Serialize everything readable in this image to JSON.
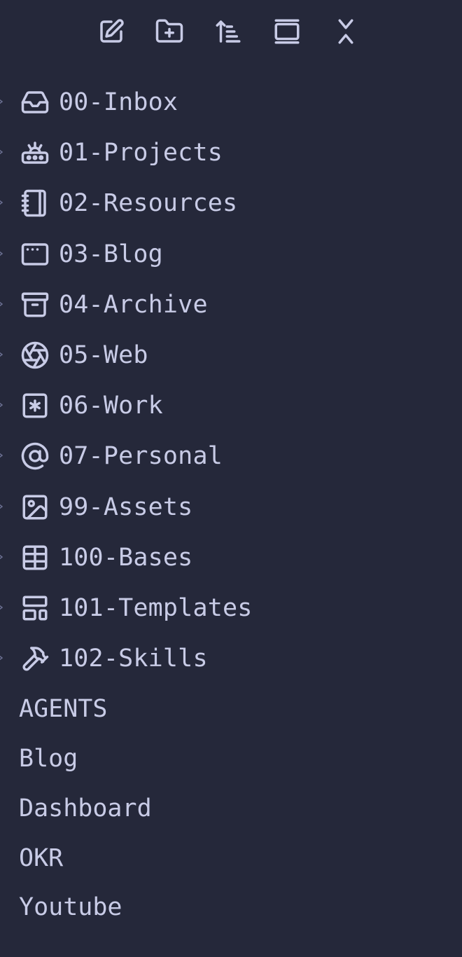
{
  "toolbar": {
    "buttons": [
      {
        "name": "new-note-button",
        "icon": "edit-icon"
      },
      {
        "name": "new-folder-button",
        "icon": "folder-plus-icon"
      },
      {
        "name": "sort-button",
        "icon": "sort-icon"
      },
      {
        "name": "auto-reveal-button",
        "icon": "reveal-icon"
      },
      {
        "name": "collapse-all-button",
        "icon": "collapse-icon"
      }
    ]
  },
  "folders": [
    {
      "label": "00-Inbox",
      "icon": "inbox-icon"
    },
    {
      "label": "01-Projects",
      "icon": "projects-icon"
    },
    {
      "label": "02-Resources",
      "icon": "notebook-icon"
    },
    {
      "label": "03-Blog",
      "icon": "browser-icon"
    },
    {
      "label": "04-Archive",
      "icon": "archive-icon"
    },
    {
      "label": "05-Web",
      "icon": "aperture-icon"
    },
    {
      "label": "06-Work",
      "icon": "asterisk-square-icon"
    },
    {
      "label": "07-Personal",
      "icon": "at-sign-icon"
    },
    {
      "label": "99-Assets",
      "icon": "image-icon"
    },
    {
      "label": "100-Bases",
      "icon": "table-icon"
    },
    {
      "label": "101-Templates",
      "icon": "layout-template-icon"
    },
    {
      "label": "102-Skills",
      "icon": "hammer-icon"
    }
  ],
  "files": [
    {
      "label": "AGENTS"
    },
    {
      "label": "Blog"
    },
    {
      "label": "Dashboard"
    },
    {
      "label": "OKR"
    },
    {
      "label": "Youtube"
    }
  ],
  "colors": {
    "background": "#25283a",
    "text": "#c8cbe6",
    "chevron": "#6a6f91"
  }
}
